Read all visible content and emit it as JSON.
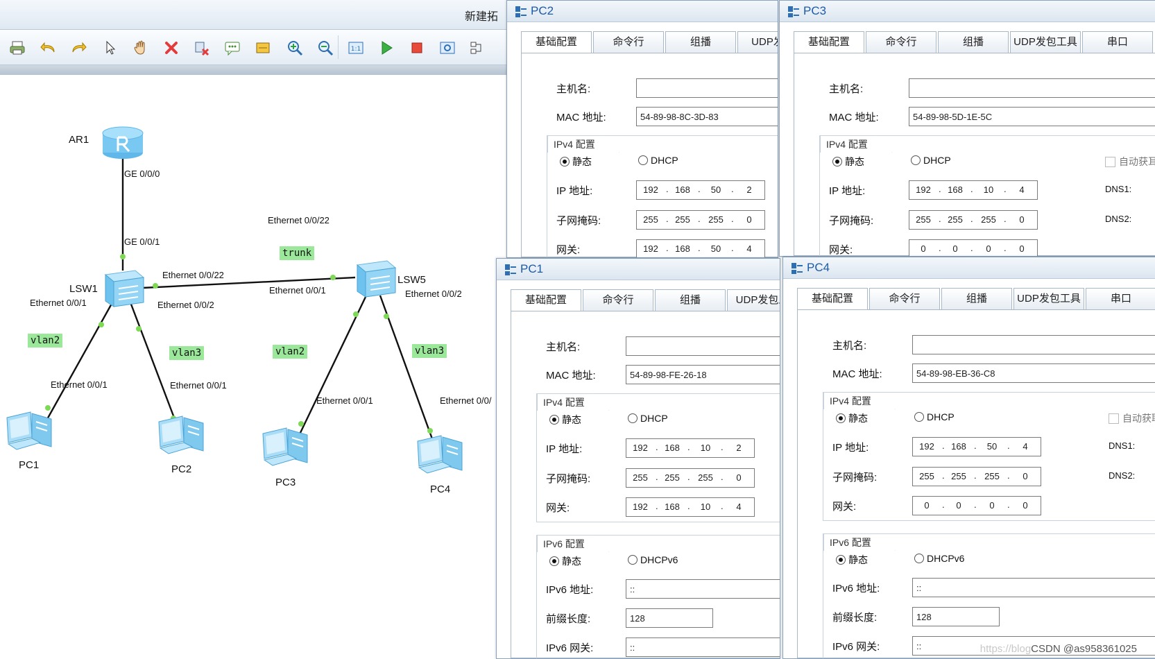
{
  "topology": {
    "title": "新建拓",
    "devices": [
      {
        "id": "ar1",
        "label": "AR1"
      },
      {
        "id": "lsw1",
        "label": "LSW1"
      },
      {
        "id": "lsw5",
        "label": "LSW5"
      },
      {
        "id": "pc1",
        "label": "PC1"
      },
      {
        "id": "pc2",
        "label": "PC2"
      },
      {
        "id": "pc3",
        "label": "PC3"
      },
      {
        "id": "pc4",
        "label": "PC4"
      }
    ],
    "ports": {
      "ar1_ge000": "GE 0/0/0",
      "lsw1_ge001": "GE 0/0/1",
      "lsw5_e0022": "Ethernet 0/0/22",
      "lsw1_e0022": "Ethernet 0/0/22",
      "lsw1_e001": "Ethernet 0/0/1",
      "lsw1_e002": "Ethernet 0/0/2",
      "lsw5_e001": "Ethernet 0/0/1",
      "lsw5_e002": "Ethernet 0/0/2",
      "pc1_e001": "Ethernet 0/0/1",
      "pc2_e001": "Ethernet 0/0/1",
      "pc3_e001": "Ethernet 0/0/1",
      "pc4_e00": "Ethernet 0/0/"
    },
    "tags": {
      "trunk": "trunk",
      "lsw1_vlan2": "vlan2",
      "lsw1_vlan3": "vlan3",
      "lsw5_vlan2": "vlan2",
      "lsw5_vlan3": "vlan3"
    },
    "link_color": "#111111",
    "port_dot_color": "#7ed957"
  },
  "labels": {
    "hostname": "主机名:",
    "mac": "MAC 地址:",
    "ipv4_group": "IPv4 配置",
    "ipv6_group": "IPv6 配置",
    "static": "静态",
    "dhcp": "DHCP",
    "dhcpv6": "DHCPv6",
    "ip": "IP 地址:",
    "mask": "子网掩码:",
    "gateway": "网关:",
    "ipv6_addr": "IPv6 地址:",
    "prefix": "前缀长度:",
    "ipv6_gw": "IPv6 网关:",
    "auto": "自动获取",
    "auto_cut": "自动获耳",
    "dns1": "DNS1:",
    "dns2": "DNS2:"
  },
  "windows": {
    "pc2": {
      "title": "PC2",
      "tabs": [
        "基础配置",
        "命令行",
        "组播",
        "UDP发包"
      ],
      "hostname": "",
      "mac": "54-89-98-8C-3D-83",
      "ip": [
        "192",
        "168",
        "50",
        "2"
      ],
      "mask": [
        "255",
        "255",
        "255",
        "0"
      ],
      "gateway": [
        "192",
        "168",
        "50",
        "4"
      ]
    },
    "pc3": {
      "title": "PC3",
      "tabs": [
        "基础配置",
        "命令行",
        "组播",
        "UDP发包工具",
        "串口"
      ],
      "hostname": "",
      "mac": "54-89-98-5D-1E-5C",
      "ip": [
        "192",
        "168",
        "10",
        "4"
      ],
      "mask": [
        "255",
        "255",
        "255",
        "0"
      ],
      "gateway": [
        "0",
        "0",
        "0",
        "0"
      ]
    },
    "pc1": {
      "title": "PC1",
      "tabs": [
        "基础配置",
        "命令行",
        "组播",
        "UDP发包工"
      ],
      "hostname": "",
      "mac": "54-89-98-FE-26-18",
      "ip": [
        "192",
        "168",
        "10",
        "2"
      ],
      "mask": [
        "255",
        "255",
        "255",
        "0"
      ],
      "gateway": [
        "192",
        "168",
        "10",
        "4"
      ],
      "ipv6": "::",
      "prefix": "128",
      "ipv6_gw": "::"
    },
    "pc4": {
      "title": "PC4",
      "tabs": [
        "基础配置",
        "命令行",
        "组播",
        "UDP发包工具",
        "串口"
      ],
      "hostname": "",
      "mac": "54-89-98-EB-36-C8",
      "ip": [
        "192",
        "168",
        "50",
        "4"
      ],
      "mask": [
        "255",
        "255",
        "255",
        "0"
      ],
      "gateway": [
        "0",
        "0",
        "0",
        "0"
      ],
      "ipv6": "::",
      "prefix": "128",
      "ipv6_gw": "::"
    }
  },
  "watermark": {
    "faint": "https://blog",
    "text": "CSDN @as958361025"
  }
}
